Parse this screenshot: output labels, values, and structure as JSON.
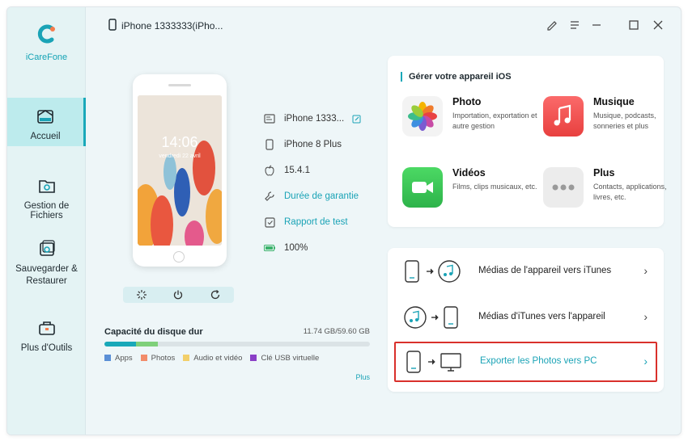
{
  "app": {
    "name": "iCareFone",
    "device_title": "iPhone 1333333(iPho..."
  },
  "sidebar": {
    "items": [
      {
        "label": "Accueil",
        "icon": "home-icon",
        "active": true
      },
      {
        "label": "Gestion de Fichiers",
        "icon": "folder-gear-icon",
        "active": false
      },
      {
        "label": "Sauvegarder & Restaurer",
        "icon": "backup-icon",
        "active": false
      },
      {
        "label": "Plus d'Outils",
        "icon": "toolbox-icon",
        "active": false
      }
    ]
  },
  "window_controls": [
    "edit-icon",
    "menu-icon",
    "minimize-icon",
    "maximize-icon",
    "close-icon"
  ],
  "phone": {
    "lock_time": "14:06",
    "lock_date": "vendredi 22 avril"
  },
  "device_info": {
    "name": "iPhone 1333...",
    "model": "iPhone 8 Plus",
    "ios_version": "15.4.1",
    "warranty_link": "Durée de garantie",
    "test_report_link": "Rapport de test",
    "battery": "100%"
  },
  "disk": {
    "title": "Capacité du disque dur",
    "size": "11.74 GB/59.60 GB",
    "used_fraction": {
      "apps": 0.12,
      "photos": 0.08
    },
    "legend": [
      {
        "label": "Apps",
        "color": "#5b8fd6"
      },
      {
        "label": "Photos",
        "color": "#f28c6a"
      },
      {
        "label": "Audio et vidéo",
        "color": "#f2cf6a"
      },
      {
        "label": "Clé USB virtuelle",
        "color": "#8a3fc7"
      }
    ],
    "more_link": "Plus"
  },
  "manage_card": {
    "title": "Gérer votre appareil iOS",
    "features": [
      {
        "name": "Photo",
        "desc": "Importation, exportation et autre gestion",
        "icon": "photos-icon"
      },
      {
        "name": "Musique",
        "desc": "Musique, podcasts, sonneries et plus",
        "icon": "music-icon"
      },
      {
        "name": "Vidéos",
        "desc": "Films, clips musicaux, etc.",
        "icon": "video-icon"
      },
      {
        "name": "Plus",
        "desc": "Contacts, applications, livres, etc.",
        "icon": "more-icon"
      }
    ]
  },
  "transfer": {
    "rows": [
      {
        "label": "Médias de l'appareil vers iTunes",
        "chevron": "›"
      },
      {
        "label": "Médias d'iTunes vers l'appareil",
        "chevron": "›"
      },
      {
        "label": "Exporter les Photos vers PC",
        "chevron": "›"
      }
    ]
  },
  "colors": {
    "accent": "#19a8b9",
    "highlight_border": "#d9302b"
  }
}
